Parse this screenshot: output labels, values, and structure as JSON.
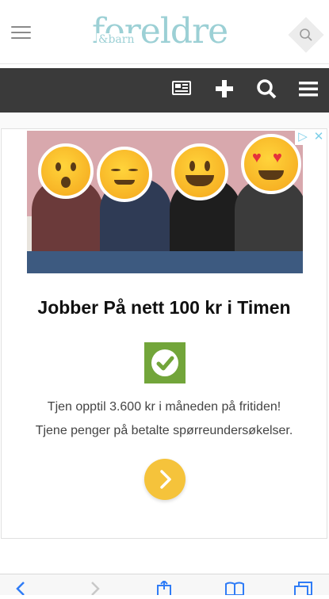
{
  "header": {
    "logo_main": "foreldre",
    "logo_sub": "&barn"
  },
  "ad": {
    "title": "Jobber På nett 100 kr i Timen",
    "line1": "Tjen opptil 3.600 kr i måneden på fritiden!",
    "line2": "Tjene penger på betalte spørreundersøkelser.",
    "badge_info": "▷",
    "badge_close": "✕"
  },
  "colors": {
    "logo": "#9cd0d5",
    "dark_bar": "#3a3a3a",
    "check_bg": "#72a53a",
    "cta_bg": "#f5c33b"
  },
  "icons": [
    "menu-icon",
    "search-icon",
    "newspaper-icon",
    "plus-icon",
    "chevron-right-icon",
    "back-icon",
    "forward-icon",
    "share-icon",
    "bookmarks-icon",
    "tabs-icon"
  ]
}
